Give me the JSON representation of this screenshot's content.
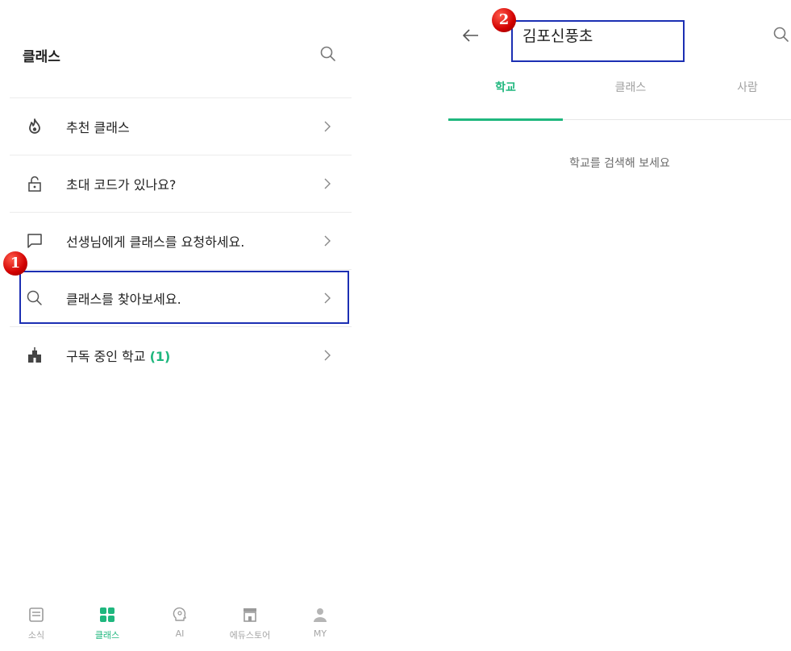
{
  "left": {
    "title": "클래스",
    "menu": [
      {
        "label": "추천 클래스",
        "icon": "flame-icon"
      },
      {
        "label": "초대 코드가 있나요?",
        "icon": "lock-icon"
      },
      {
        "label": "선생님에게 클래스를 요청하세요.",
        "icon": "chat-icon"
      },
      {
        "label": "클래스를 찾아보세요.",
        "icon": "search-icon"
      },
      {
        "label": "구독 중인 학교",
        "count": "(1)",
        "icon": "school-icon"
      }
    ],
    "annotation_badge": "1"
  },
  "bottom_nav": [
    {
      "label": "소식",
      "icon": "news-icon"
    },
    {
      "label": "클래스",
      "icon": "grid-icon",
      "active": true
    },
    {
      "label": "AI",
      "icon": "ai-brain-icon"
    },
    {
      "label": "에듀스토어",
      "icon": "store-icon"
    },
    {
      "label": "MY",
      "icon": "person-icon"
    }
  ],
  "right": {
    "search_value": "김포신풍초",
    "tabs": [
      "학교",
      "클래스",
      "사람"
    ],
    "active_tab": "학교",
    "empty_message": "학교를 검색해 보세요",
    "annotation_badge": "2"
  },
  "colors": {
    "accent": "#1fb77e",
    "highlight_box": "#1c2fb3",
    "badge": "#d10000"
  }
}
